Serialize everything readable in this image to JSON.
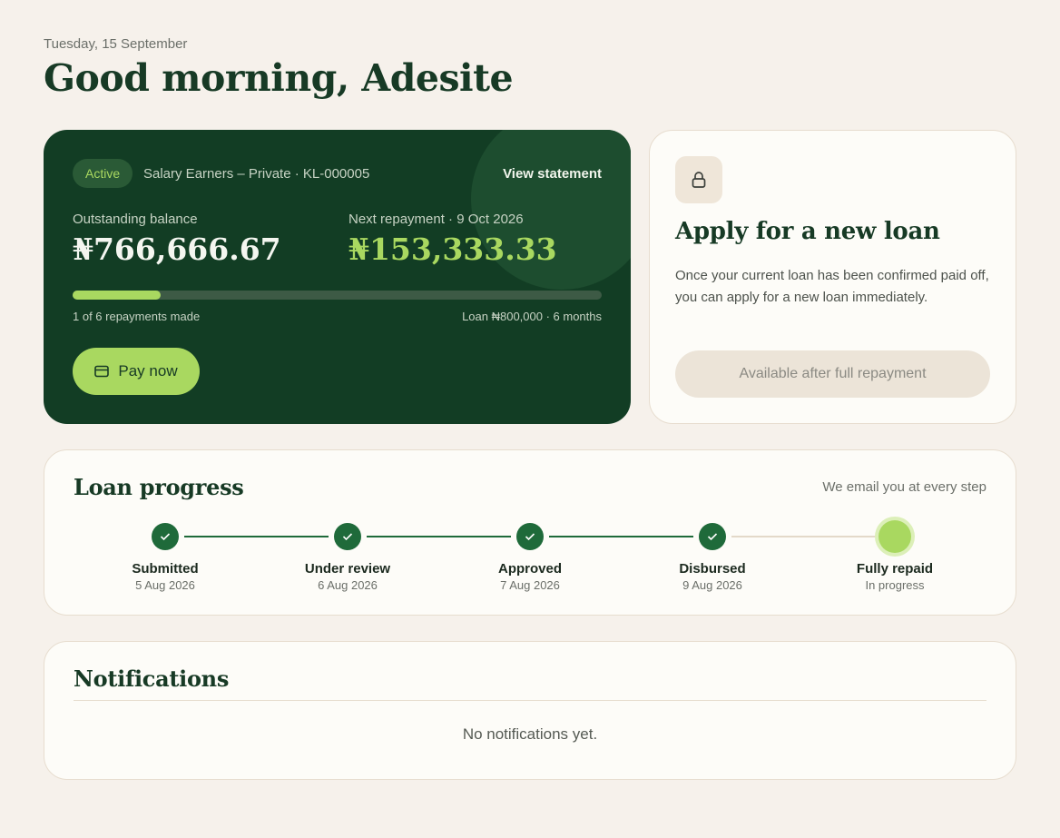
{
  "header": {
    "date": "Tuesday, 15 September",
    "greeting": "Good morning, Adesite"
  },
  "loan": {
    "status": "Active",
    "meta": "Salary Earners – Private · KL-000005",
    "view_statement": "View statement",
    "outstanding_label": "Outstanding balance",
    "outstanding_value": "₦766,666.67",
    "next_label": "Next repayment · 9 Oct 2026",
    "next_value": "₦153,333.33",
    "progress_fraction": 0.1667,
    "repayments_text": "1 of 6 repayments made",
    "terms_text": "Loan ₦800,000 · 6 months",
    "pay_label": "Pay now",
    "pay_icon": "card-icon"
  },
  "apply": {
    "icon": "lock-icon",
    "title": "Apply for a new loan",
    "body": "Once your current loan has been confirmed paid off, you can apply for a new loan immediately.",
    "button_label": "Available after full repayment"
  },
  "progress": {
    "title": "Loan progress",
    "note": "We email you at every step",
    "steps": [
      {
        "label": "Submitted",
        "date": "5 Aug 2026",
        "done": true
      },
      {
        "label": "Under review",
        "date": "6 Aug 2026",
        "done": true
      },
      {
        "label": "Approved",
        "date": "7 Aug 2026",
        "done": true
      },
      {
        "label": "Disbursed",
        "date": "9 Aug 2026",
        "done": true
      },
      {
        "label": "Fully repaid",
        "date": "In progress",
        "done": false
      }
    ]
  },
  "notifications": {
    "title": "Notifications",
    "empty_text": "No notifications yet."
  },
  "colors": {
    "accent_green": "#a9d860",
    "dark_green": "#123d24",
    "step_done": "#1f6a3a",
    "step_pending_line": "#e3d9c9"
  }
}
